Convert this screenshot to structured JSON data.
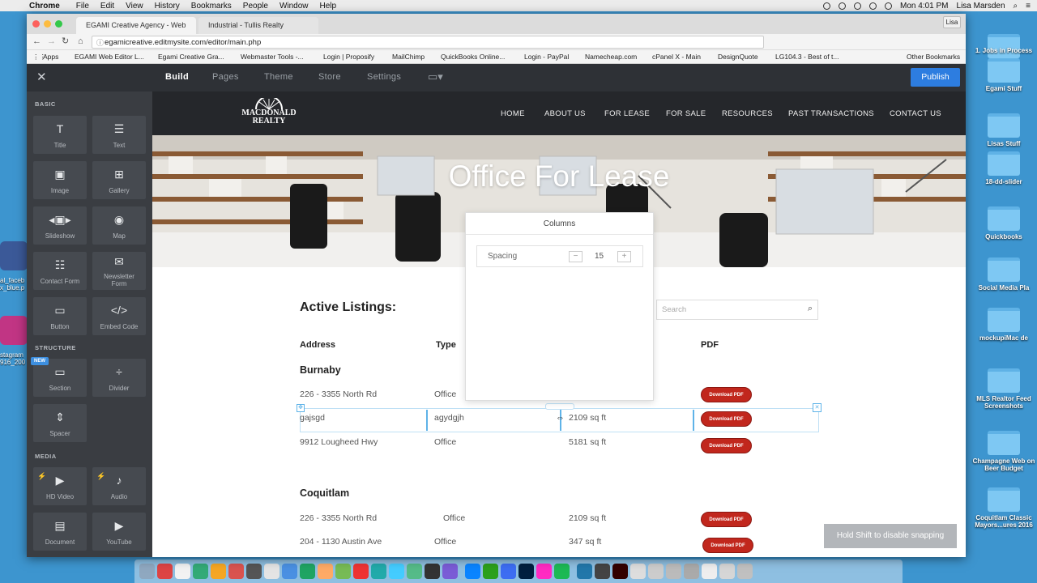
{
  "menubar": {
    "apple": "",
    "app": "Chrome",
    "items": [
      "File",
      "Edit",
      "View",
      "History",
      "Bookmarks",
      "People",
      "Window",
      "Help"
    ],
    "clock": "Mon 4:01 PM",
    "user": "Lisa Marsden"
  },
  "desktop": {
    "icons": [
      "1. Jobs in Process",
      "Egami Stuff",
      "Lisas Stuff",
      "18-dd-slider",
      "Quickbooks",
      "Social Media Pla",
      "mockupiMac de",
      "MLS Realtor Feed Screenshots",
      "Champagne Web on Beer Budget",
      "Coquitlam Classic Mayors...ures 2016"
    ],
    "left_labels": [
      "al_faceb x_blue.p",
      "stagram 916_200"
    ]
  },
  "browser": {
    "tabs": [
      {
        "title": "EGAMI Creative Agency - Web"
      },
      {
        "title": "Industrial - Tullis Realty"
      }
    ],
    "profile": "Lisa",
    "url": "egamicreative.editmysite.com/editor/main.php",
    "bookmarks": [
      "Apps",
      "EGAMI Web Editor L...",
      "Egami Creative Gra...",
      "Webmaster Tools -...",
      "Login | Proposify",
      "MailChimp",
      "QuickBooks Online...",
      "Login - PayPal",
      "Namecheap.com",
      "cPanel X - Main",
      "DesignQuote",
      "LG104.3 - Best of t...",
      "Other Bookmarks"
    ]
  },
  "editor": {
    "nav": [
      "Build",
      "Pages",
      "Theme",
      "Store",
      "Settings"
    ],
    "publish": "Publish",
    "sidebar": {
      "basic_title": "BASIC",
      "basic": [
        "Title",
        "Text",
        "Image",
        "Gallery",
        "Slideshow",
        "Map",
        "Contact Form",
        "Newsletter Form",
        "Button",
        "Embed Code"
      ],
      "structure_title": "STRUCTURE",
      "structure": [
        "Section",
        "Divider",
        "Spacer"
      ],
      "new_badge": "NEW",
      "media_title": "MEDIA",
      "media": [
        "HD Video",
        "Audio",
        "Document",
        "YouTube"
      ]
    }
  },
  "site": {
    "logo_line1": "MACDONALD",
    "logo_line2": "REALTY",
    "nav": [
      "HOME",
      "ABOUT US",
      "FOR LEASE",
      "FOR SALE",
      "RESOURCES",
      "PAST TRANSACTIONS",
      "CONTACT US"
    ],
    "hero_title": "Office For Lease",
    "listings_title": "Active Listings:",
    "search_placeholder": "Search",
    "headers": [
      "Address",
      "Type",
      "PDF"
    ],
    "pdf_label": "Download PDF",
    "groups": [
      {
        "city": "Burnaby",
        "rows": [
          {
            "address": "226 - 3355 North Rd",
            "type": "Office",
            "size": ""
          },
          {
            "address": "gajsgd",
            "type": "agydgjh",
            "size": "2109 sq ft"
          },
          {
            "address": "9912 Lougheed Hwy",
            "type": "Office",
            "size": "5181 sq ft"
          }
        ]
      },
      {
        "city": "Coquitlam",
        "rows": [
          {
            "address": "226 - 3355 North Rd",
            "type": "Office",
            "size": "2109 sq ft"
          },
          {
            "address": "204 - 1130 Austin Ave",
            "type": "Office",
            "size": "347 sq ft"
          }
        ]
      }
    ]
  },
  "columns_panel": {
    "title": "Columns",
    "spacing_label": "Spacing",
    "spacing_value": "15",
    "minus": "−",
    "plus": "+"
  },
  "toast": "Hold Shift to disable snapping"
}
